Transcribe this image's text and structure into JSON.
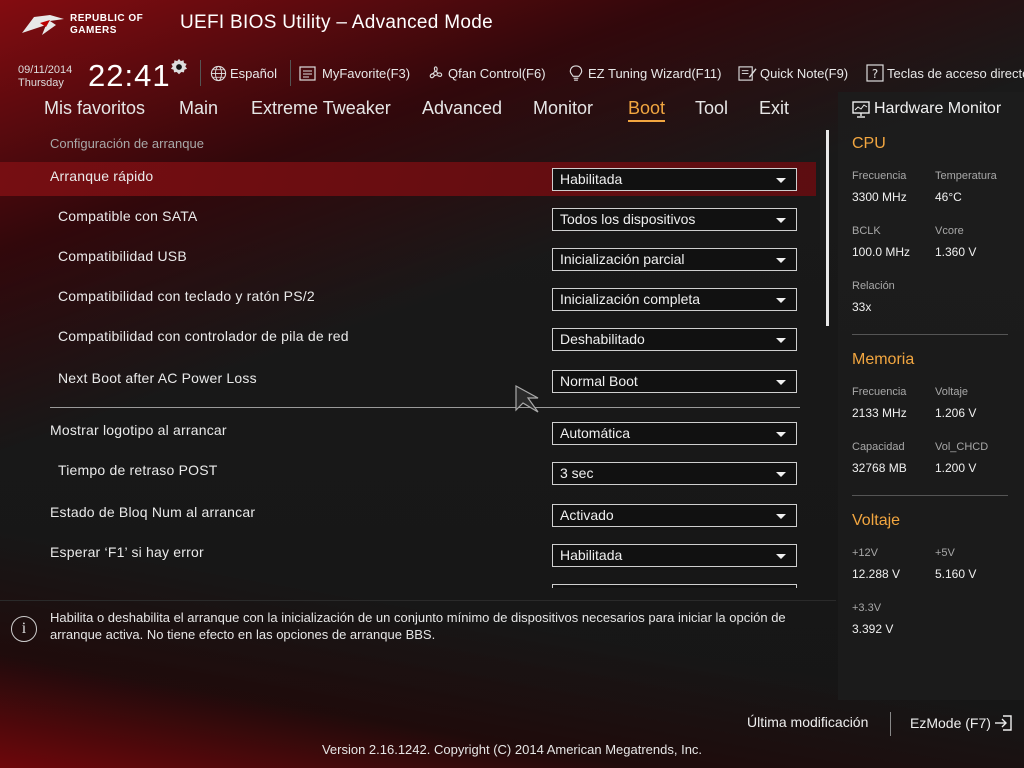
{
  "header": {
    "brand_line1": "REPUBLIC OF",
    "brand_line2": "GAMERS",
    "title": "UEFI BIOS Utility – Advanced Mode"
  },
  "toolbar": {
    "date": "09/11/2014",
    "day": "Thursday",
    "time": "22:41",
    "language": "Español",
    "myfavorite": "MyFavorite(F3)",
    "qfan": "Qfan Control(F6)",
    "ez_tuning": "EZ Tuning Wizard(F11)",
    "quick_note": "Quick Note(F9)",
    "hotkeys": "Teclas de acceso directo"
  },
  "nav": {
    "tabs": [
      {
        "label": "Mis favoritos"
      },
      {
        "label": "Main"
      },
      {
        "label": "Extreme Tweaker"
      },
      {
        "label": "Advanced"
      },
      {
        "label": "Monitor"
      },
      {
        "label": "Boot",
        "active": true
      },
      {
        "label": "Tool"
      },
      {
        "label": "Exit"
      }
    ]
  },
  "main": {
    "breadcrumb": "Configuración de arranque",
    "settings": [
      {
        "label": "Arranque rápido",
        "value": "Habilitada"
      },
      {
        "label": "Compatible con SATA",
        "value": "Todos los dispositivos"
      },
      {
        "label": "Compatibilidad USB",
        "value": "Inicialización parcial"
      },
      {
        "label": "Compatibilidad con teclado y ratón PS/2",
        "value": "Inicialización completa"
      },
      {
        "label": "Compatibilidad con controlador de pila de red",
        "value": "Deshabilitado"
      },
      {
        "label": "Next Boot after AC Power Loss",
        "value": "Normal Boot"
      },
      {
        "label": "Mostrar logotipo al arrancar",
        "value": "Automática"
      },
      {
        "label": "Tiempo de retraso POST",
        "value": "3 sec"
      },
      {
        "label": "Estado de Bloq Num al arrancar",
        "value": "Activado"
      },
      {
        "label": "Esperar ‘F1’ si hay error",
        "value": "Habilitada"
      }
    ]
  },
  "info": {
    "icon": "i",
    "text": "Habilita o deshabilita el arranque con la inicialización de un conjunto mínimo de dispositivos necesarios para iniciar la opción de arranque activa. No tiene efecto en las opciones de arranque BBS."
  },
  "hwmonitor": {
    "title": "Hardware Monitor",
    "cpu": {
      "heading": "CPU",
      "freq_label": "Frecuencia",
      "freq": "3300 MHz",
      "temp_label": "Temperatura",
      "temp": "46°C",
      "bclk_label": "BCLK",
      "bclk": "100.0 MHz",
      "vcore_label": "Vcore",
      "vcore": "1.360 V",
      "ratio_label": "Relación",
      "ratio": "33x"
    },
    "memory": {
      "heading": "Memoria",
      "freq_label": "Frecuencia",
      "freq": "2133 MHz",
      "volt_label": "Voltaje",
      "volt": "1.206 V",
      "cap_label": "Capacidad",
      "cap": "32768 MB",
      "vchcd_label": "Vol_CHCD",
      "vchcd": "1.200 V"
    },
    "voltage": {
      "heading": "Voltaje",
      "v12_label": "+12V",
      "v12": "12.288 V",
      "v5_label": "+5V",
      "v5": "5.160 V",
      "v33_label": "+3.3V",
      "v33": "3.392 V"
    }
  },
  "footer": {
    "last_modified": "Última modificación",
    "ezmode": "EzMode (F7)",
    "version": "Version 2.16.1242. Copyright (C) 2014 American Megatrends, Inc."
  },
  "colors": {
    "accent": "#f2a640",
    "highlight_row": "#7a0e12"
  }
}
